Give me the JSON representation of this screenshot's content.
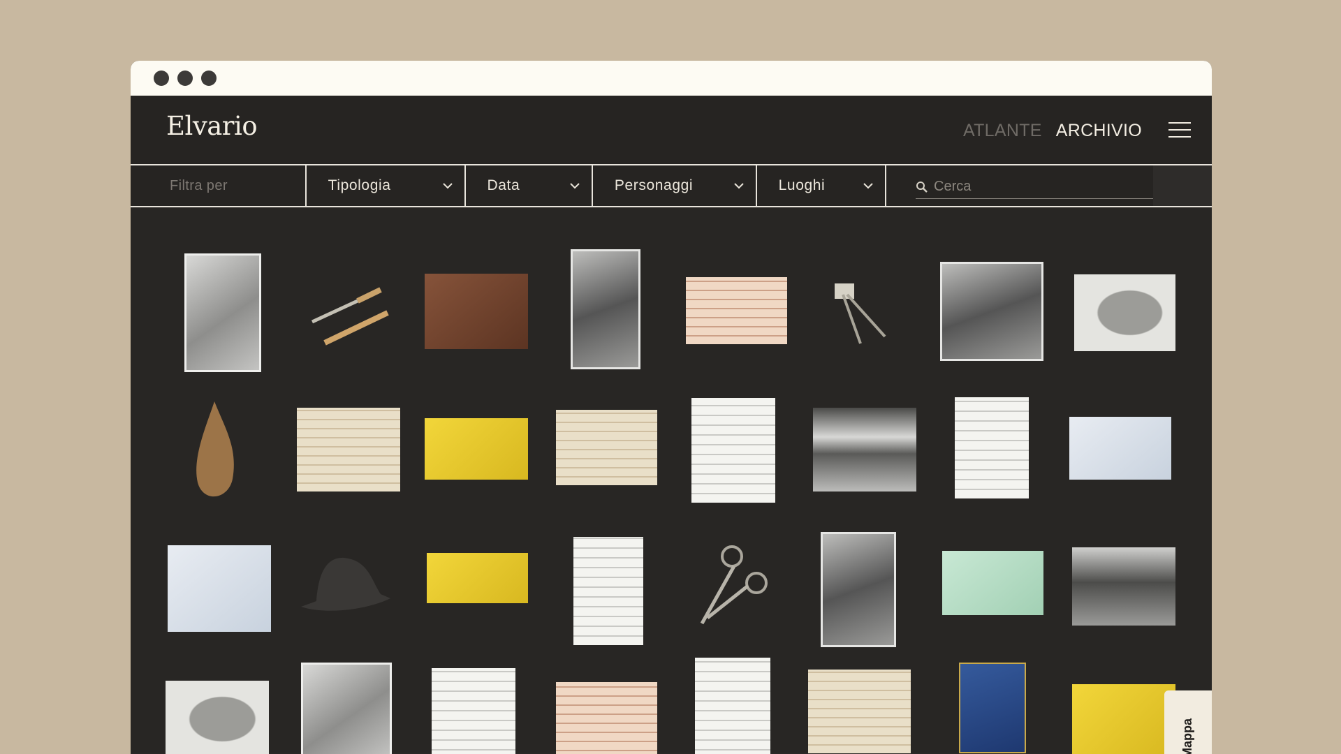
{
  "window": {
    "dots": 3
  },
  "header": {
    "logo": "Elvario",
    "nav": [
      {
        "label": "ATLANTE",
        "active": false
      },
      {
        "label": "ARCHIVIO",
        "active": true
      }
    ]
  },
  "filters": {
    "label": "Filtra per",
    "dropdowns": [
      "Tipologia",
      "Data",
      "Personaggi",
      "Luoghi"
    ],
    "search_placeholder": "Cerca"
  },
  "side_tab": {
    "label": "Mappa"
  },
  "colors": {
    "background": "#c8b8a0",
    "app_bg": "#262422",
    "text_light": "#f2ede2",
    "nav_inactive": "#6f6b66"
  },
  "icons": [
    "menu-icon",
    "chevron-down-icon",
    "search-icon"
  ]
}
